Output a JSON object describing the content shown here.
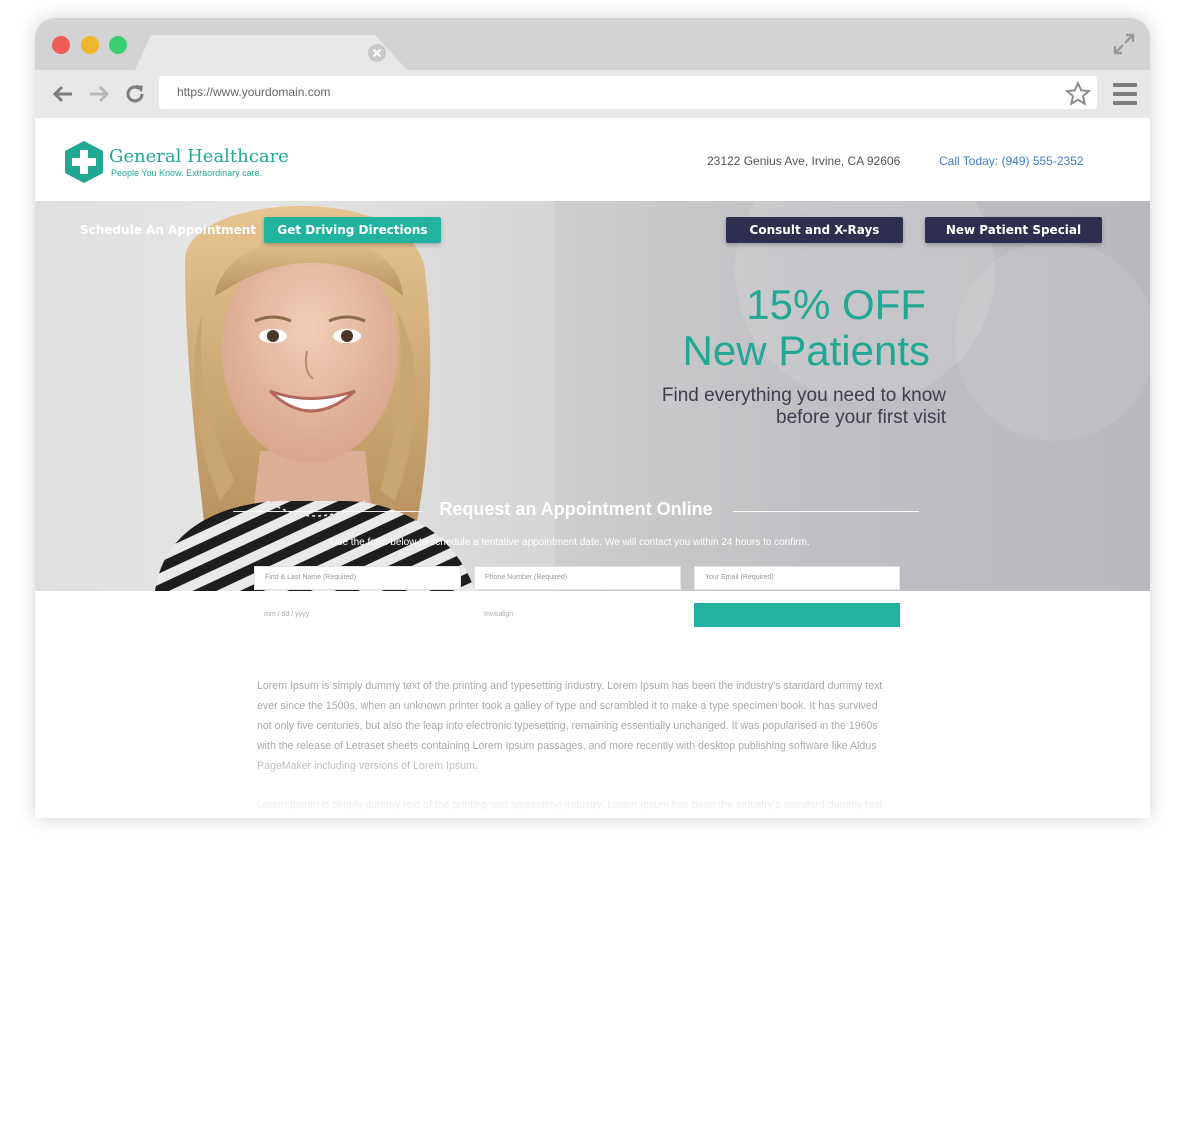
{
  "browser": {
    "url": "https://www.yourdomain.com",
    "colors": {
      "close": "#ed5c55",
      "minimize": "#efb62c",
      "maximize": "#3ccf72"
    }
  },
  "header": {
    "brand_name": "General Healthcare",
    "tagline": "People You Know. Extraordinary care.",
    "address": "23122 Genius Ave, Irvine, CA 92606",
    "call": "Call Today: (949) 555-2352",
    "brand_color": "#21a893"
  },
  "hero": {
    "nav_link": "Schedule An Appointment",
    "buttons": [
      {
        "label": "Get Driving Directions",
        "color": "#21b3a0"
      },
      {
        "label": "Consult and X-Rays",
        "color": "#2e2f4f"
      },
      {
        "label": "New Patient Special",
        "color": "#2e2f4f"
      }
    ],
    "promo": {
      "discount": "15% OFF",
      "title": "New Patients",
      "subtitle_line1": "Find everything you need to know",
      "subtitle_line2": "before your first visit"
    }
  },
  "form": {
    "title": "Request an Appointment Online",
    "description": "Use the form below to schedule a tentative appointment date. We will contact you within 24 hours to confirm.",
    "name_placeholder": "First & Last Name (Required)",
    "phone_placeholder": "Phone Number (Required)",
    "email_placeholder": "Your Email (Required)",
    "date_placeholder": "mm / dd / yyyy",
    "service_value": "Invisalign"
  },
  "content": {
    "paragraphs": [
      "Lorem Ipsum is simply dummy text of the printing and typesetting industry. Lorem Ipsum has been the industry's standard dummy text ever since the 1500s, when an unknown printer took a galley of type and scrambled it to make a type specimen book. It has survived not only five centuries, but also the leap into electronic typesetting, remaining essentially unchanged. It was popularised in the 1960s with the release of Letraset sheets containing Lorem Ipsum passages, and more recently with desktop publishing software like Aldus PageMaker including versions of Lorem Ipsum.",
      "Lorem Ipsum is simply dummy text of the printing and typesetting industry. Lorem Ipsum has been the industry's standard dummy text ever since the 1500s, when an unknown printer took a galley of type and scrambled it to make a type specimen book. It has survived not only five centuries, but also the leap into electronic typesetting, remaining essentially unchanged. It was popularised in the 1960s with the release of Letraset sheets containing Lorem Ipsum passages, and more recently with desktop publishing software like Aldus PageMaker including versions of Lorem Ipsum."
    ]
  }
}
